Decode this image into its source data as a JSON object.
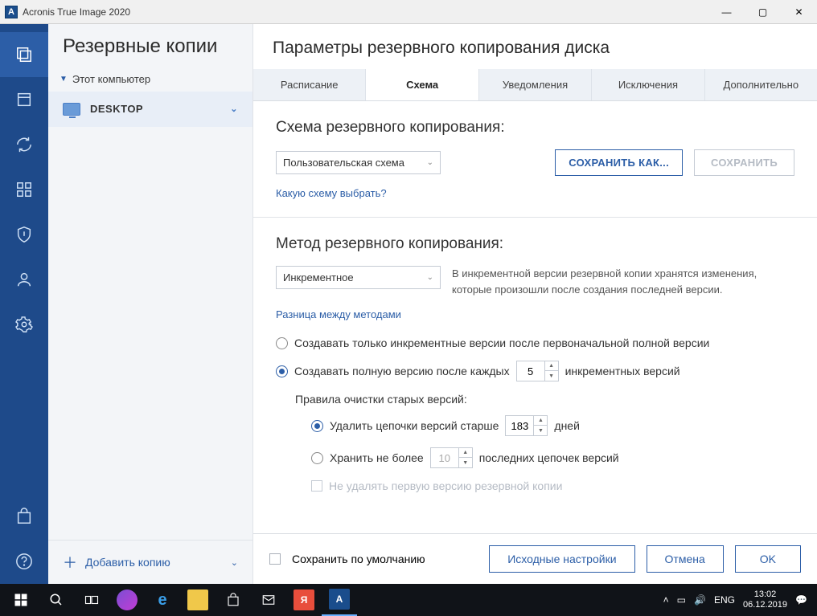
{
  "titlebar": {
    "app": "Acronis True Image 2020",
    "iconLetter": "A"
  },
  "nav": {
    "items": [
      "backup",
      "archive",
      "sync",
      "dashboard",
      "protection",
      "account",
      "settings"
    ]
  },
  "sidebar": {
    "heading": "Резервные копии",
    "root": "Этот компьютер",
    "item": "DESKTOP",
    "add": "Добавить копию"
  },
  "header": "Параметры резервного копирования диска",
  "tabs": [
    "Расписание",
    "Схема",
    "Уведомления",
    "Исключения",
    "Дополнительно"
  ],
  "activeTab": 1,
  "scheme": {
    "title": "Схема резервного копирования:",
    "select": "Пользовательская схема",
    "saveAs": "СОХРАНИТЬ КАК...",
    "save": "СОХРАНИТЬ",
    "helpLink": "Какую схему выбрать?"
  },
  "method": {
    "title": "Метод резервного копирования:",
    "select": "Инкрементное",
    "desc": "В инкрементной версии резервной копии хранятся изменения, которые произошли после создания последней версии.",
    "diffLink": "Разница между методами",
    "opt1": "Создавать только инкрементные версии после первоначальной полной версии",
    "opt2a": "Создавать полную версию после каждых",
    "opt2n": "5",
    "opt2b": "инкрементных версий",
    "rulesLabel": "Правила очистки старых версий:",
    "ruleA_a": "Удалить цепочки версий старше",
    "ruleA_n": "183",
    "ruleA_b": "дней",
    "ruleB_a": "Хранить не более",
    "ruleB_n": "10",
    "ruleB_b": "последних цепочек версий",
    "keepFirst": "Не удалять первую версию резервной копии"
  },
  "footer": {
    "default": "Сохранить по умолчанию",
    "reset": "Исходные настройки",
    "cancel": "Отмена",
    "ok": "OK"
  },
  "taskbar": {
    "lang": "ENG",
    "time": "13:02",
    "date": "06.12.2019"
  }
}
